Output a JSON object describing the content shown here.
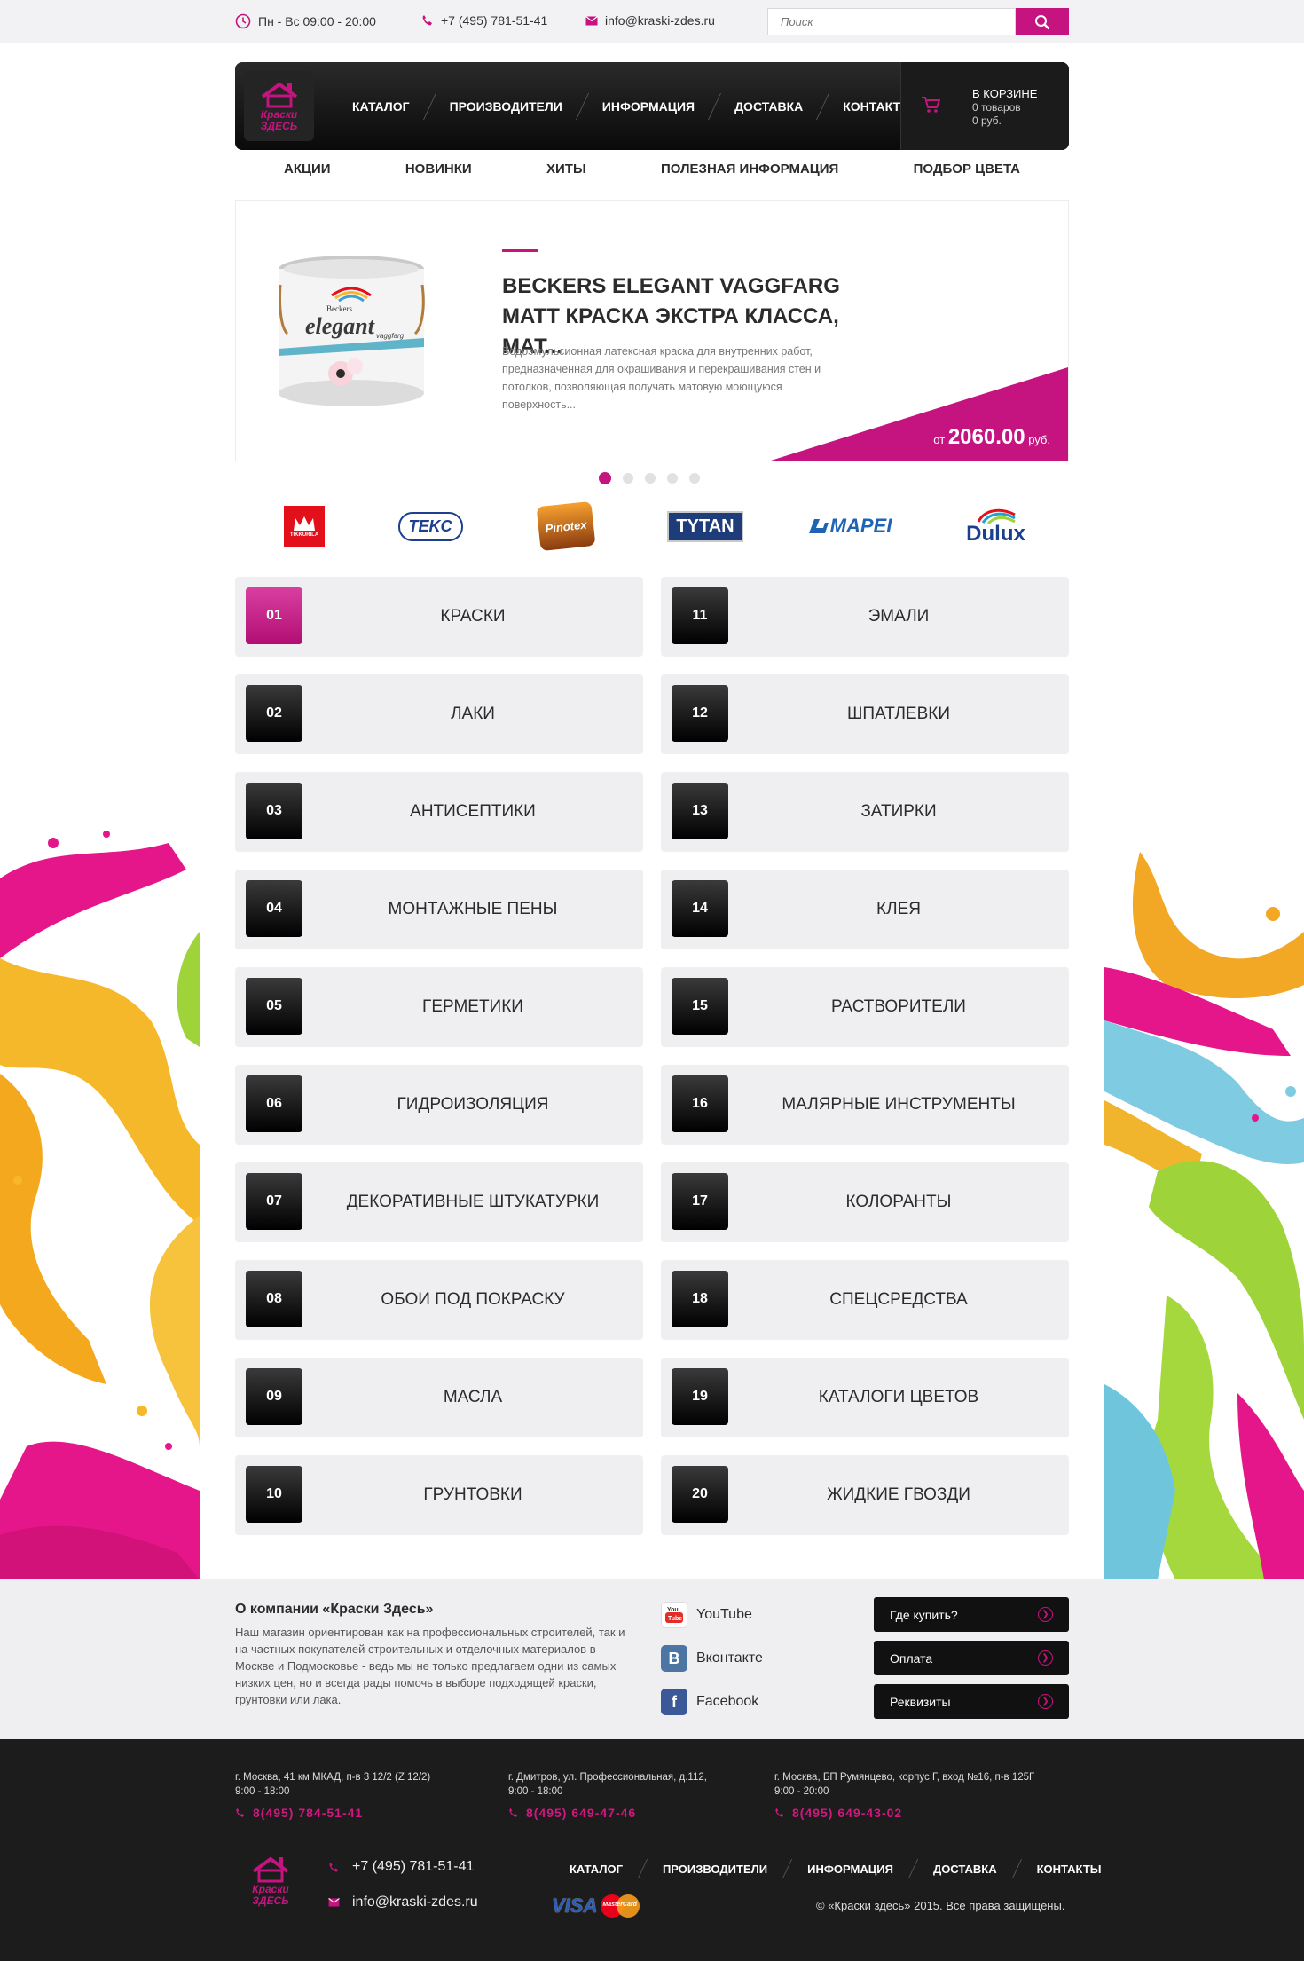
{
  "topbar": {
    "hours": "Пн - Вс  09:00 - 20:00",
    "phone": "+7 (495) 781-51-41",
    "email": "info@kraski-zdes.ru",
    "search_placeholder": "Поиск"
  },
  "logo": {
    "line1": "Краски",
    "line2": "Здесь"
  },
  "nav": [
    "КАТАЛОГ",
    "ПРОИЗВОДИТЕЛИ",
    "ИНФОРМАЦИЯ",
    "ДОСТАВКА",
    "КОНТАКТЫ"
  ],
  "cart": {
    "title": "В КОРЗИНЕ",
    "items": "0 товаров",
    "sum": "0 руб."
  },
  "subnav": [
    "АКЦИИ",
    "НОВИНКИ",
    "ХИТЫ",
    "ПОЛЕЗНАЯ ИНФОРМАЦИЯ",
    "ПОДБОР ЦВЕТА"
  ],
  "slide": {
    "title": "BECKERS ELEGANT VAGGFARG MATT КРАСКА ЭКСТРА КЛАССА, МАТ...",
    "description": "Водоэмульсионная латексная краска для внутренних работ, предназначенная для окрашивания и перекрашивания стен и потолков, позволяющая получать матовую моющуюся поверхность...",
    "price_prefix": "от",
    "price": "2060.00",
    "price_suffix": "руб.",
    "can_brand": "Beckers",
    "can_name": "elegant",
    "can_sub": "vaggfarg",
    "active_dot": 0,
    "dots_count": 5
  },
  "brands": [
    {
      "name": "TIKKURILA",
      "color": "#e3101b"
    },
    {
      "name": "TEKC",
      "color": "#1d3f8f"
    },
    {
      "name": "Pinotex",
      "color": "#e3701a"
    },
    {
      "name": "TYTAN",
      "color": "#1e3c7a"
    },
    {
      "name": "MAPEI",
      "color": "#1f64b4"
    },
    {
      "name": "Dulux",
      "color": "#1b3f8f"
    }
  ],
  "categories": [
    {
      "num": "01",
      "label": "КРАСКИ",
      "active": true
    },
    {
      "num": "02",
      "label": "ЛАКИ"
    },
    {
      "num": "03",
      "label": "АНТИСЕПТИКИ"
    },
    {
      "num": "04",
      "label": "МОНТАЖНЫЕ ПЕНЫ"
    },
    {
      "num": "05",
      "label": "ГЕРМЕТИКИ"
    },
    {
      "num": "06",
      "label": "ГИДРОИЗОЛЯЦИЯ"
    },
    {
      "num": "07",
      "label": "ДЕКОРАТИВНЫЕ ШТУКАТУРКИ"
    },
    {
      "num": "08",
      "label": "ОБОИ ПОД ПОКРАСКУ"
    },
    {
      "num": "09",
      "label": "МАСЛА"
    },
    {
      "num": "10",
      "label": "ГРУНТОВКИ"
    },
    {
      "num": "11",
      "label": "ЭМАЛИ"
    },
    {
      "num": "12",
      "label": "ШПАТЛЕВКИ"
    },
    {
      "num": "13",
      "label": "ЗАТИРКИ"
    },
    {
      "num": "14",
      "label": "КЛЕЯ"
    },
    {
      "num": "15",
      "label": "РАСТВОРИТЕЛИ"
    },
    {
      "num": "16",
      "label": "МАЛЯРНЫЕ ИНСТРУМЕНТЫ"
    },
    {
      "num": "17",
      "label": "КОЛОРАНТЫ"
    },
    {
      "num": "18",
      "label": "СПЕЦСРЕДСТВА"
    },
    {
      "num": "19",
      "label": "КАТАЛОГИ ЦВЕТОВ"
    },
    {
      "num": "20",
      "label": "ЖИДКИЕ ГВОЗДИ"
    }
  ],
  "about": {
    "title": "О компании «Краски Здесь»",
    "text": "Наш магазин ориентирован как на профессиональных строителей, так и на частных покупателей строительных и отделочных материалов в Москве и Подмосковье - ведь мы не только предлагаем одни из самых низких цен, но и всегда рады помочь в выборе подходящей краски, грунтовки или лака."
  },
  "social": [
    {
      "name": "YouTube",
      "icon": "youtube-icon",
      "color": "#e52d27"
    },
    {
      "name": "Вконтакте",
      "icon": "vk-icon",
      "color": "#4c75a3"
    },
    {
      "name": "Facebook",
      "icon": "facebook-icon",
      "color": "#3b5998"
    }
  ],
  "footer_buttons": [
    "Где купить?",
    "Оплата",
    "Реквизиты"
  ],
  "addresses": [
    {
      "address": "г. Москва, 41 км МКАД, п-в 3 12/2 (Z 12/2)",
      "hours": "9:00 - 18:00",
      "phone": "8(495) 784-51-41"
    },
    {
      "address": "г. Дмитров, ул. Профессиональная, д.112,",
      "hours": "9:00 - 18:00",
      "phone": "8(495) 649-47-46"
    },
    {
      "address": "г. Москва, БП Румянцево, корпус Г, вход №16, п-в 125Г",
      "hours": "9:00 - 20:00",
      "phone": "8(495) 649-43-02"
    }
  ],
  "footer": {
    "phone": "+7 (495) 781-51-41",
    "email": "info@kraski-zdes.ru",
    "nav": [
      "КАТАЛОГ",
      "ПРОИЗВОДИТЕЛИ",
      "ИНФОРМАЦИЯ",
      "ДОСТАВКА",
      "КОНТАКТЫ"
    ],
    "copyright": "©  «Краски здесь» 2015. Все права защищены.",
    "payments": [
      "VISA",
      "MasterCard"
    ]
  },
  "colors": {
    "accent": "#c5137f",
    "dark": "#1c1c1c",
    "tile": "#efeff1"
  }
}
